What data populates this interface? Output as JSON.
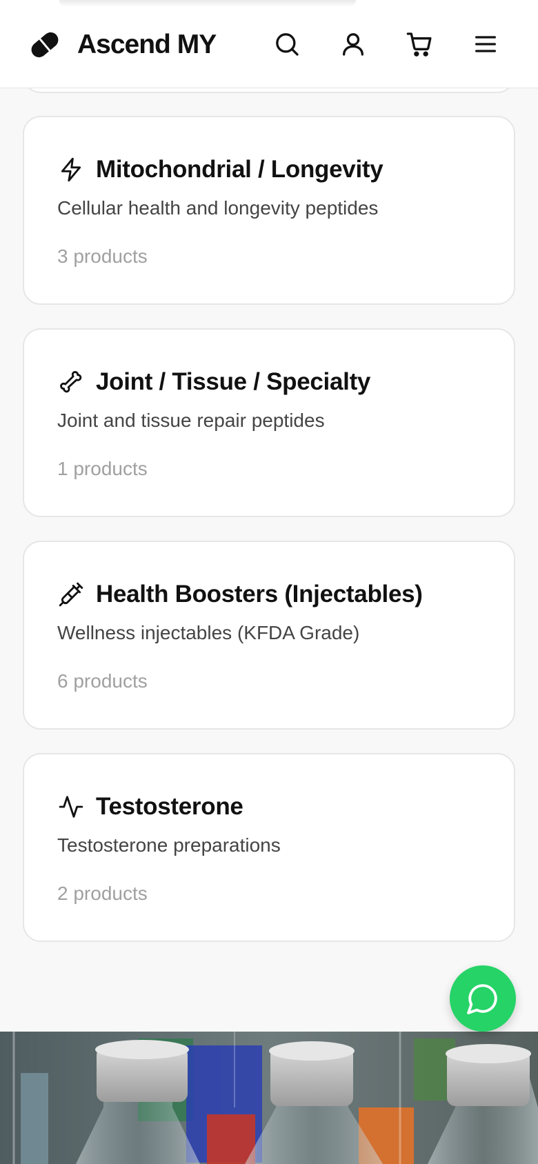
{
  "header": {
    "brand": "Ascend MY",
    "icons": [
      "search-icon",
      "user-icon",
      "cart-icon",
      "menu-icon"
    ]
  },
  "categories": [
    {
      "icon": "zap-icon",
      "title": "Mitochondrial / Longevity",
      "description": "Cellular health and longevity peptides",
      "count": "3 products"
    },
    {
      "icon": "bone-icon",
      "title": "Joint / Tissue / Specialty",
      "description": "Joint and tissue repair peptides",
      "count": "1 products"
    },
    {
      "icon": "syringe-icon",
      "title": "Health Boosters (Injectables)",
      "description": "Wellness injectables (KFDA Grade)",
      "count": "6 products"
    },
    {
      "icon": "activity-icon",
      "title": "Testosterone",
      "description": "Testosterone preparations",
      "count": "2 products"
    }
  ],
  "chat": {
    "icon": "chat-icon",
    "color": "#25d366"
  },
  "colors": {
    "card_border": "#e6e6e6",
    "background": "#f8f8f8",
    "count_text": "#a0a0a0"
  }
}
